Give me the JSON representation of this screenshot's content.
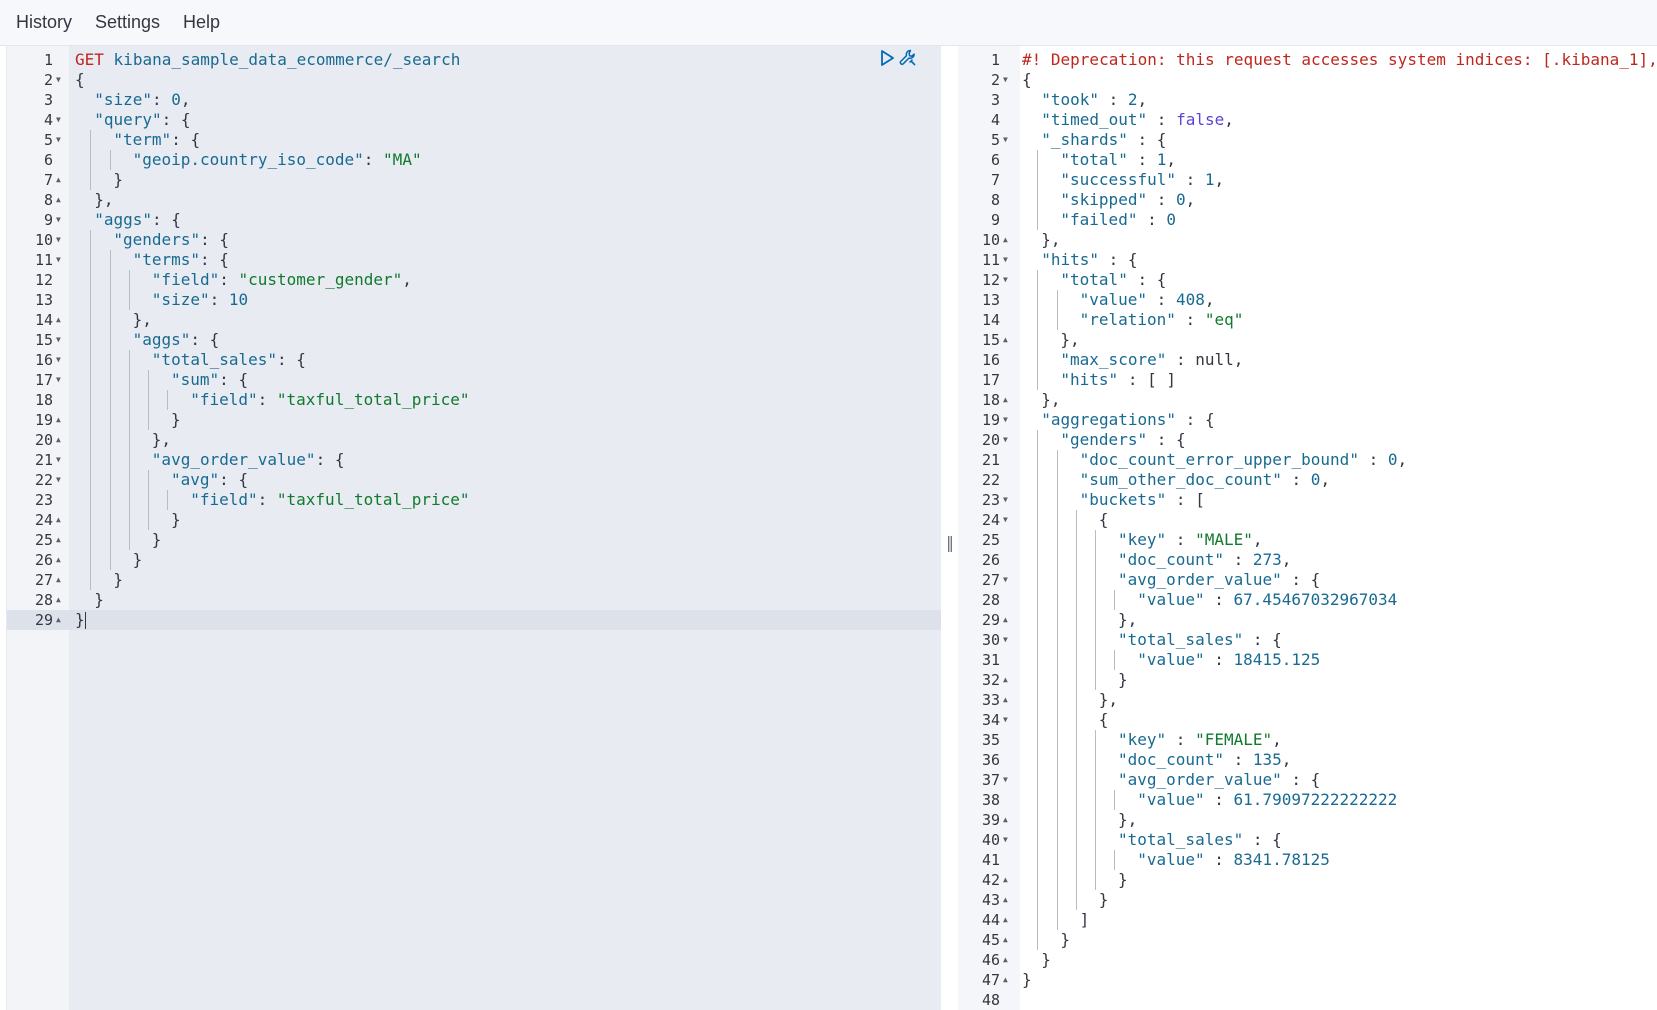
{
  "menu": {
    "history": "History",
    "settings": "Settings",
    "help": "Help"
  },
  "divider_handle": "‖",
  "icons": {
    "run": "play-icon",
    "settings": "wrench-icon"
  },
  "colors": {
    "method": "#bd271e",
    "key": "#196a91",
    "string": "#117a2e",
    "boolean": "#5a45d6",
    "warning": "#bd271e"
  },
  "request": {
    "method": "GET",
    "path": "kibana_sample_data_ecommerce/_search",
    "lines": [
      {
        "n": "1",
        "f": "",
        "ind": 0,
        "t": [
          [
            "m",
            "GET"
          ],
          [
            "p",
            " "
          ],
          [
            "k",
            "kibana_sample_data_ecommerce/_search"
          ]
        ]
      },
      {
        "n": "2",
        "f": "▼",
        "ind": 0,
        "t": [
          [
            "p",
            "{"
          ]
        ]
      },
      {
        "n": "3",
        "f": "",
        "ind": 1,
        "t": [
          [
            "k",
            "\"size\""
          ],
          [
            "p",
            ": "
          ],
          [
            "n",
            "0"
          ],
          [
            "p",
            ","
          ]
        ]
      },
      {
        "n": "4",
        "f": "▼",
        "ind": 1,
        "t": [
          [
            "k",
            "\"query\""
          ],
          [
            "p",
            ": {"
          ]
        ]
      },
      {
        "n": "5",
        "f": "▼",
        "ind": 2,
        "t": [
          [
            "k",
            "\"term\""
          ],
          [
            "p",
            ": {"
          ]
        ]
      },
      {
        "n": "6",
        "f": "",
        "ind": 3,
        "t": [
          [
            "k",
            "\"geoip.country_iso_code\""
          ],
          [
            "p",
            ": "
          ],
          [
            "s",
            "\"MA\""
          ]
        ]
      },
      {
        "n": "7",
        "f": "▲",
        "ind": 2,
        "t": [
          [
            "p",
            "}"
          ]
        ]
      },
      {
        "n": "8",
        "f": "▲",
        "ind": 1,
        "t": [
          [
            "p",
            "},"
          ]
        ]
      },
      {
        "n": "9",
        "f": "▼",
        "ind": 1,
        "t": [
          [
            "k",
            "\"aggs\""
          ],
          [
            "p",
            ": {"
          ]
        ]
      },
      {
        "n": "10",
        "f": "▼",
        "ind": 2,
        "t": [
          [
            "k",
            "\"genders\""
          ],
          [
            "p",
            ": {"
          ]
        ]
      },
      {
        "n": "11",
        "f": "▼",
        "ind": 3,
        "t": [
          [
            "k",
            "\"terms\""
          ],
          [
            "p",
            ": {"
          ]
        ]
      },
      {
        "n": "12",
        "f": "",
        "ind": 4,
        "t": [
          [
            "k",
            "\"field\""
          ],
          [
            "p",
            ": "
          ],
          [
            "s",
            "\"customer_gender\""
          ],
          [
            "p",
            ","
          ]
        ]
      },
      {
        "n": "13",
        "f": "",
        "ind": 4,
        "t": [
          [
            "k",
            "\"size\""
          ],
          [
            "p",
            ": "
          ],
          [
            "n",
            "10"
          ]
        ]
      },
      {
        "n": "14",
        "f": "▲",
        "ind": 3,
        "t": [
          [
            "p",
            "},"
          ]
        ]
      },
      {
        "n": "15",
        "f": "▼",
        "ind": 3,
        "t": [
          [
            "k",
            "\"aggs\""
          ],
          [
            "p",
            ": {"
          ]
        ]
      },
      {
        "n": "16",
        "f": "▼",
        "ind": 4,
        "t": [
          [
            "k",
            "\"total_sales\""
          ],
          [
            "p",
            ": {"
          ]
        ]
      },
      {
        "n": "17",
        "f": "▼",
        "ind": 5,
        "t": [
          [
            "k",
            "\"sum\""
          ],
          [
            "p",
            ": {"
          ]
        ]
      },
      {
        "n": "18",
        "f": "",
        "ind": 6,
        "t": [
          [
            "k",
            "\"field\""
          ],
          [
            "p",
            ": "
          ],
          [
            "s",
            "\"taxful_total_price\""
          ]
        ]
      },
      {
        "n": "19",
        "f": "▲",
        "ind": 5,
        "t": [
          [
            "p",
            "}"
          ]
        ]
      },
      {
        "n": "20",
        "f": "▲",
        "ind": 4,
        "t": [
          [
            "p",
            "},"
          ]
        ]
      },
      {
        "n": "21",
        "f": "▼",
        "ind": 4,
        "t": [
          [
            "k",
            "\"avg_order_value\""
          ],
          [
            "p",
            ": {"
          ]
        ]
      },
      {
        "n": "22",
        "f": "▼",
        "ind": 5,
        "t": [
          [
            "k",
            "\"avg\""
          ],
          [
            "p",
            ": {"
          ]
        ]
      },
      {
        "n": "23",
        "f": "",
        "ind": 6,
        "t": [
          [
            "k",
            "\"field\""
          ],
          [
            "p",
            ": "
          ],
          [
            "s",
            "\"taxful_total_price\""
          ]
        ]
      },
      {
        "n": "24",
        "f": "▲",
        "ind": 5,
        "t": [
          [
            "p",
            "}"
          ]
        ]
      },
      {
        "n": "25",
        "f": "▲",
        "ind": 4,
        "t": [
          [
            "p",
            "}"
          ]
        ]
      },
      {
        "n": "26",
        "f": "▲",
        "ind": 3,
        "t": [
          [
            "p",
            "}"
          ]
        ]
      },
      {
        "n": "27",
        "f": "▲",
        "ind": 2,
        "t": [
          [
            "p",
            "}"
          ]
        ]
      },
      {
        "n": "28",
        "f": "▲",
        "ind": 1,
        "t": [
          [
            "p",
            "}"
          ]
        ]
      },
      {
        "n": "29",
        "f": "▲",
        "ind": 0,
        "t": [
          [
            "p",
            "}"
          ]
        ],
        "active": true
      }
    ]
  },
  "response": {
    "lines": [
      {
        "n": "1",
        "f": "",
        "ind": 0,
        "t": [
          [
            "c",
            "#! Deprecation: this request accesses system indices: [.kibana_1],"
          ]
        ]
      },
      {
        "n": "2",
        "f": "▼",
        "ind": 0,
        "t": [
          [
            "p",
            "{"
          ]
        ]
      },
      {
        "n": "3",
        "f": "",
        "ind": 1,
        "t": [
          [
            "k",
            "\"took\""
          ],
          [
            "p",
            " : "
          ],
          [
            "n",
            "2"
          ],
          [
            "p",
            ","
          ]
        ]
      },
      {
        "n": "4",
        "f": "",
        "ind": 1,
        "t": [
          [
            "k",
            "\"timed_out\""
          ],
          [
            "p",
            " : "
          ],
          [
            "b",
            "false"
          ],
          [
            "p",
            ","
          ]
        ]
      },
      {
        "n": "5",
        "f": "▼",
        "ind": 1,
        "t": [
          [
            "k",
            "\"_shards\""
          ],
          [
            "p",
            " : {"
          ]
        ]
      },
      {
        "n": "6",
        "f": "",
        "ind": 2,
        "t": [
          [
            "k",
            "\"total\""
          ],
          [
            "p",
            " : "
          ],
          [
            "n",
            "1"
          ],
          [
            "p",
            ","
          ]
        ]
      },
      {
        "n": "7",
        "f": "",
        "ind": 2,
        "t": [
          [
            "k",
            "\"successful\""
          ],
          [
            "p",
            " : "
          ],
          [
            "n",
            "1"
          ],
          [
            "p",
            ","
          ]
        ]
      },
      {
        "n": "8",
        "f": "",
        "ind": 2,
        "t": [
          [
            "k",
            "\"skipped\""
          ],
          [
            "p",
            " : "
          ],
          [
            "n",
            "0"
          ],
          [
            "p",
            ","
          ]
        ]
      },
      {
        "n": "9",
        "f": "",
        "ind": 2,
        "t": [
          [
            "k",
            "\"failed\""
          ],
          [
            "p",
            " : "
          ],
          [
            "n",
            "0"
          ]
        ]
      },
      {
        "n": "10",
        "f": "▲",
        "ind": 1,
        "t": [
          [
            "p",
            "},"
          ]
        ]
      },
      {
        "n": "11",
        "f": "▼",
        "ind": 1,
        "t": [
          [
            "k",
            "\"hits\""
          ],
          [
            "p",
            " : {"
          ]
        ]
      },
      {
        "n": "12",
        "f": "▼",
        "ind": 2,
        "t": [
          [
            "k",
            "\"total\""
          ],
          [
            "p",
            " : {"
          ]
        ]
      },
      {
        "n": "13",
        "f": "",
        "ind": 3,
        "t": [
          [
            "k",
            "\"value\""
          ],
          [
            "p",
            " : "
          ],
          [
            "n",
            "408"
          ],
          [
            "p",
            ","
          ]
        ]
      },
      {
        "n": "14",
        "f": "",
        "ind": 3,
        "t": [
          [
            "k",
            "\"relation\""
          ],
          [
            "p",
            " : "
          ],
          [
            "s",
            "\"eq\""
          ]
        ]
      },
      {
        "n": "15",
        "f": "▲",
        "ind": 2,
        "t": [
          [
            "p",
            "},"
          ]
        ]
      },
      {
        "n": "16",
        "f": "",
        "ind": 2,
        "t": [
          [
            "k",
            "\"max_score\""
          ],
          [
            "p",
            " : null,"
          ]
        ]
      },
      {
        "n": "17",
        "f": "",
        "ind": 2,
        "t": [
          [
            "k",
            "\"hits\""
          ],
          [
            "p",
            " : [ ]"
          ]
        ]
      },
      {
        "n": "18",
        "f": "▲",
        "ind": 1,
        "t": [
          [
            "p",
            "},"
          ]
        ]
      },
      {
        "n": "19",
        "f": "▼",
        "ind": 1,
        "t": [
          [
            "k",
            "\"aggregations\""
          ],
          [
            "p",
            " : {"
          ]
        ]
      },
      {
        "n": "20",
        "f": "▼",
        "ind": 2,
        "t": [
          [
            "k",
            "\"genders\""
          ],
          [
            "p",
            " : {"
          ]
        ]
      },
      {
        "n": "21",
        "f": "",
        "ind": 3,
        "t": [
          [
            "k",
            "\"doc_count_error_upper_bound\""
          ],
          [
            "p",
            " : "
          ],
          [
            "n",
            "0"
          ],
          [
            "p",
            ","
          ]
        ]
      },
      {
        "n": "22",
        "f": "",
        "ind": 3,
        "t": [
          [
            "k",
            "\"sum_other_doc_count\""
          ],
          [
            "p",
            " : "
          ],
          [
            "n",
            "0"
          ],
          [
            "p",
            ","
          ]
        ]
      },
      {
        "n": "23",
        "f": "▼",
        "ind": 3,
        "t": [
          [
            "k",
            "\"buckets\""
          ],
          [
            "p",
            " : ["
          ]
        ]
      },
      {
        "n": "24",
        "f": "▼",
        "ind": 4,
        "t": [
          [
            "p",
            "{"
          ]
        ]
      },
      {
        "n": "25",
        "f": "",
        "ind": 5,
        "t": [
          [
            "k",
            "\"key\""
          ],
          [
            "p",
            " : "
          ],
          [
            "s",
            "\"MALE\""
          ],
          [
            "p",
            ","
          ]
        ]
      },
      {
        "n": "26",
        "f": "",
        "ind": 5,
        "t": [
          [
            "k",
            "\"doc_count\""
          ],
          [
            "p",
            " : "
          ],
          [
            "n",
            "273"
          ],
          [
            "p",
            ","
          ]
        ]
      },
      {
        "n": "27",
        "f": "▼",
        "ind": 5,
        "t": [
          [
            "k",
            "\"avg_order_value\""
          ],
          [
            "p",
            " : {"
          ]
        ]
      },
      {
        "n": "28",
        "f": "",
        "ind": 6,
        "t": [
          [
            "k",
            "\"value\""
          ],
          [
            "p",
            " : "
          ],
          [
            "n",
            "67.45467032967034"
          ]
        ]
      },
      {
        "n": "29",
        "f": "▲",
        "ind": 5,
        "t": [
          [
            "p",
            "},"
          ]
        ]
      },
      {
        "n": "30",
        "f": "▼",
        "ind": 5,
        "t": [
          [
            "k",
            "\"total_sales\""
          ],
          [
            "p",
            " : {"
          ]
        ]
      },
      {
        "n": "31",
        "f": "",
        "ind": 6,
        "t": [
          [
            "k",
            "\"value\""
          ],
          [
            "p",
            " : "
          ],
          [
            "n",
            "18415.125"
          ]
        ]
      },
      {
        "n": "32",
        "f": "▲",
        "ind": 5,
        "t": [
          [
            "p",
            "}"
          ]
        ]
      },
      {
        "n": "33",
        "f": "▲",
        "ind": 4,
        "t": [
          [
            "p",
            "},"
          ]
        ]
      },
      {
        "n": "34",
        "f": "▼",
        "ind": 4,
        "t": [
          [
            "p",
            "{"
          ]
        ]
      },
      {
        "n": "35",
        "f": "",
        "ind": 5,
        "t": [
          [
            "k",
            "\"key\""
          ],
          [
            "p",
            " : "
          ],
          [
            "s",
            "\"FEMALE\""
          ],
          [
            "p",
            ","
          ]
        ]
      },
      {
        "n": "36",
        "f": "",
        "ind": 5,
        "t": [
          [
            "k",
            "\"doc_count\""
          ],
          [
            "p",
            " : "
          ],
          [
            "n",
            "135"
          ],
          [
            "p",
            ","
          ]
        ]
      },
      {
        "n": "37",
        "f": "▼",
        "ind": 5,
        "t": [
          [
            "k",
            "\"avg_order_value\""
          ],
          [
            "p",
            " : {"
          ]
        ]
      },
      {
        "n": "38",
        "f": "",
        "ind": 6,
        "t": [
          [
            "k",
            "\"value\""
          ],
          [
            "p",
            " : "
          ],
          [
            "n",
            "61.79097222222222"
          ]
        ]
      },
      {
        "n": "39",
        "f": "▲",
        "ind": 5,
        "t": [
          [
            "p",
            "},"
          ]
        ]
      },
      {
        "n": "40",
        "f": "▼",
        "ind": 5,
        "t": [
          [
            "k",
            "\"total_sales\""
          ],
          [
            "p",
            " : {"
          ]
        ]
      },
      {
        "n": "41",
        "f": "",
        "ind": 6,
        "t": [
          [
            "k",
            "\"value\""
          ],
          [
            "p",
            " : "
          ],
          [
            "n",
            "8341.78125"
          ]
        ]
      },
      {
        "n": "42",
        "f": "▲",
        "ind": 5,
        "t": [
          [
            "p",
            "}"
          ]
        ]
      },
      {
        "n": "43",
        "f": "▲",
        "ind": 4,
        "t": [
          [
            "p",
            "}"
          ]
        ]
      },
      {
        "n": "44",
        "f": "▲",
        "ind": 3,
        "t": [
          [
            "p",
            "]"
          ]
        ]
      },
      {
        "n": "45",
        "f": "▲",
        "ind": 2,
        "t": [
          [
            "p",
            "}"
          ]
        ]
      },
      {
        "n": "46",
        "f": "▲",
        "ind": 1,
        "t": [
          [
            "p",
            "}"
          ]
        ]
      },
      {
        "n": "47",
        "f": "▲",
        "ind": 0,
        "t": [
          [
            "p",
            "}"
          ]
        ]
      },
      {
        "n": "48",
        "f": "",
        "ind": 0,
        "t": []
      }
    ]
  }
}
